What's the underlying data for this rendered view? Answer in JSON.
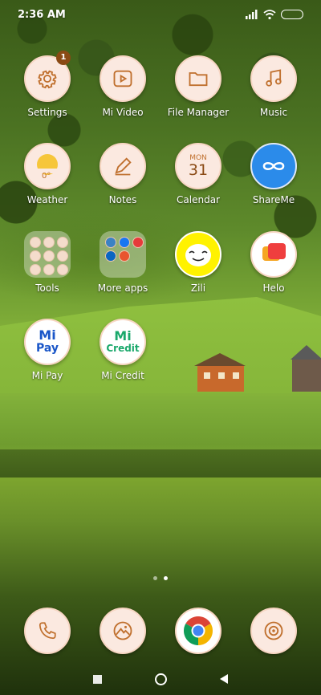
{
  "status": {
    "time": "2:36 AM"
  },
  "apps": {
    "row1": [
      {
        "label": "Settings",
        "badge": "1"
      },
      {
        "label": "Mi Video"
      },
      {
        "label": "File Manager"
      },
      {
        "label": "Music"
      }
    ],
    "row2": [
      {
        "label": "Weather",
        "temp": "0°"
      },
      {
        "label": "Notes"
      },
      {
        "label": "Calendar",
        "day": "MON",
        "date": "31"
      },
      {
        "label": "ShareMe"
      }
    ],
    "row3": [
      {
        "label": "Tools"
      },
      {
        "label": "More apps"
      },
      {
        "label": "Zili"
      },
      {
        "label": "Helo"
      }
    ],
    "row4": [
      {
        "label": "Mi Pay",
        "logo_top": "Mi",
        "logo_bottom": "Pay"
      },
      {
        "label": "Mi Credit",
        "logo_top": "Mi",
        "logo_bottom": "Credit"
      }
    ]
  },
  "page_indicator": {
    "pages": 2,
    "current": 2
  },
  "colors": {
    "icon_bg": "#fbe9e0",
    "accent": "#c0702e",
    "mipay_blue": "#1a56c8",
    "micredit_green": "#1aa86b"
  }
}
